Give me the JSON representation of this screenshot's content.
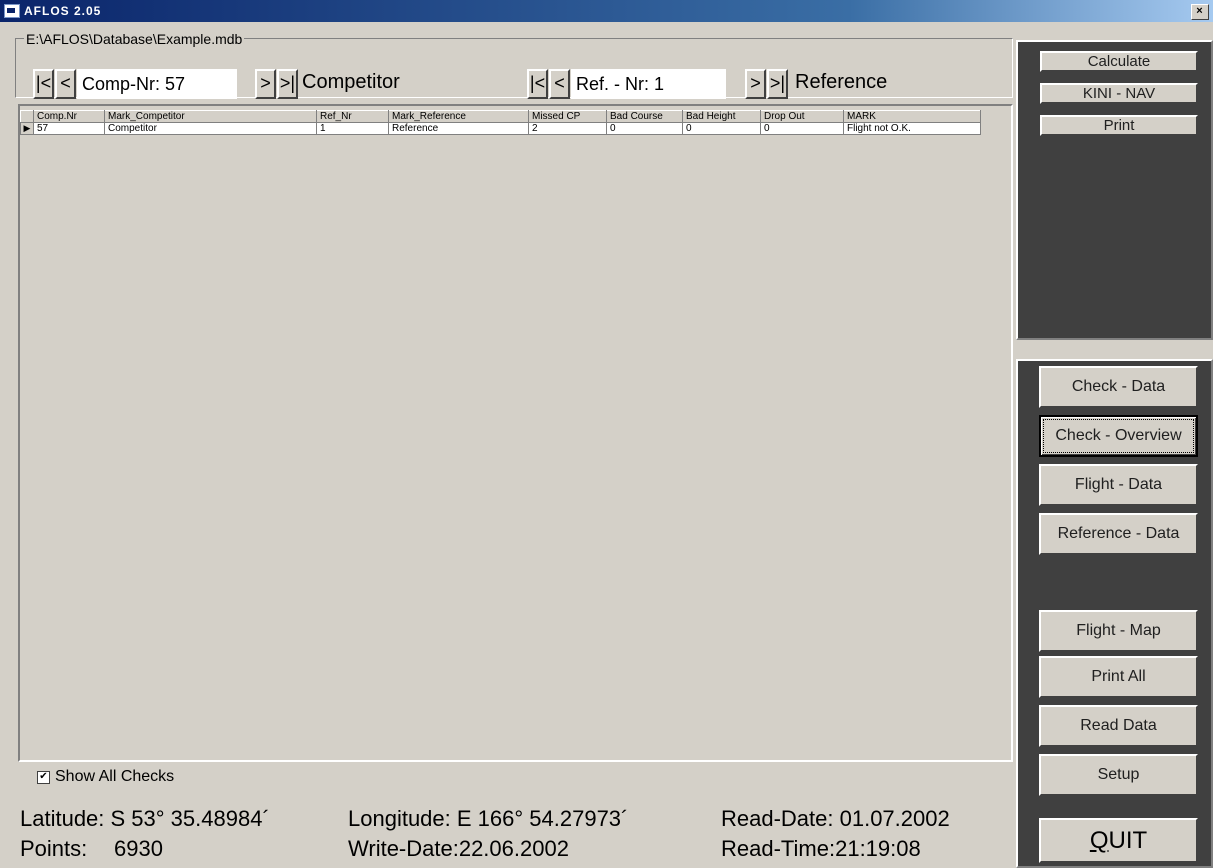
{
  "window": {
    "title": "AFLOS 2.05",
    "close_label": "×"
  },
  "database": {
    "path": "E:\\AFLOS\\Database\\Example.mdb"
  },
  "navigators": {
    "competitor": {
      "first": "|<",
      "prev": "<",
      "field": "Comp-Nr: 57",
      "next": ">",
      "last": ">|",
      "label": "Competitor"
    },
    "reference": {
      "first": "|<",
      "prev": "<",
      "field": "Ref. - Nr: 1",
      "next": ">",
      "last": ">|",
      "label": "Reference"
    }
  },
  "grid": {
    "columns": [
      "Comp.Nr",
      "Mark_Competitor",
      "Ref_Nr",
      "Mark_Reference",
      "Missed CP",
      "Bad Course",
      "Bad Height",
      "Drop Out",
      "MARK"
    ],
    "rows": [
      [
        "57",
        "Competitor",
        "1",
        "Reference",
        "2",
        "0",
        "0",
        "0",
        "Flight not O.K."
      ]
    ]
  },
  "show_all_checks": {
    "label": "Show All Checks",
    "checked": true
  },
  "status": {
    "latitude": "Latitude: S 53° 35.48984´",
    "longitude": "Longitude: E 166° 54.27973´",
    "read_date": "Read-Date: 01.07.2002",
    "points_label": "Points:",
    "points_value": "6930",
    "write_date": "Write-Date:22.06.2002",
    "read_time": "Read-Time:21:19:08"
  },
  "top_buttons": {
    "calculate": "Calculate",
    "kini_nav": "KINI - NAV",
    "print": "Print"
  },
  "side_buttons": {
    "check_data": "Check - Data",
    "check_overview": "Check - Overview",
    "flight_data": "Flight - Data",
    "reference_data": "Reference - Data",
    "flight_map": "Flight - Map",
    "print_all": "Print All",
    "read_data": "Read Data",
    "setup": "Setup",
    "quit": "QUIT"
  },
  "colors": {
    "face": "#d4d0c8",
    "panel_dark": "#404040",
    "titlebar": "#0a246a"
  }
}
